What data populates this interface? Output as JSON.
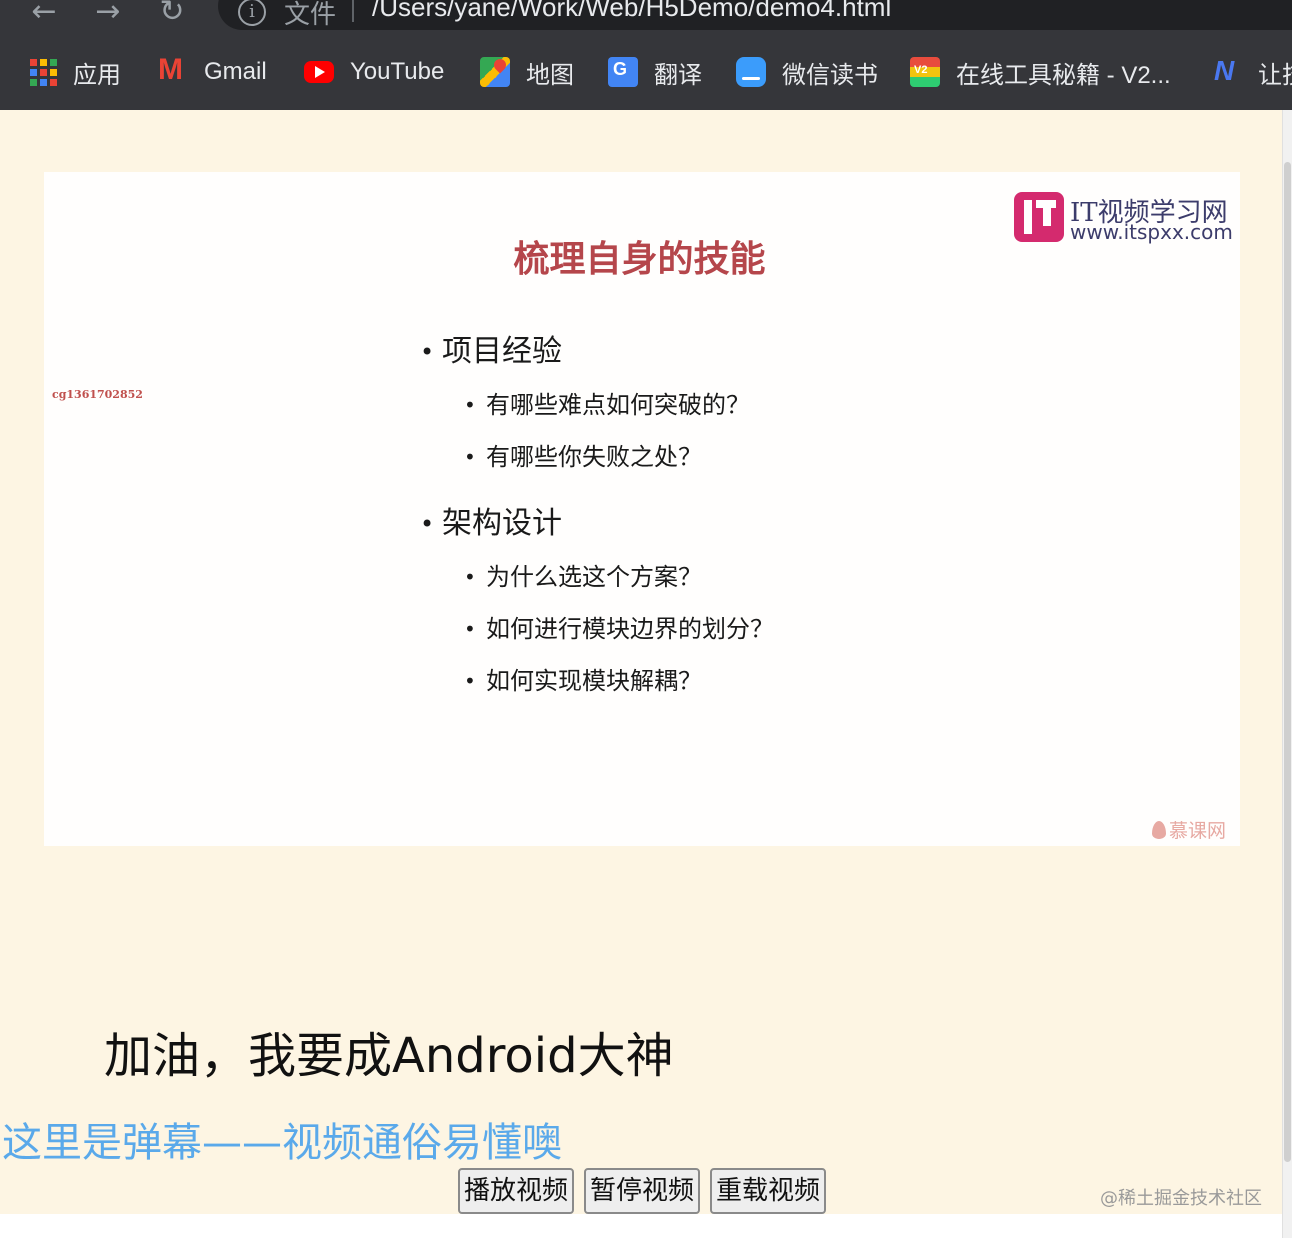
{
  "browser": {
    "address_label": "文件",
    "url": "/Users/yane/Work/Web/H5Demo/demo4.html",
    "info_icon": "i",
    "bookmarks": [
      {
        "label": "应用",
        "icon": "apps-grid-icon"
      },
      {
        "label": "Gmail",
        "icon": "gmail-icon"
      },
      {
        "label": "YouTube",
        "icon": "youtube-icon"
      },
      {
        "label": "地图",
        "icon": "maps-icon"
      },
      {
        "label": "翻译",
        "icon": "translate-icon"
      },
      {
        "label": "微信读书",
        "icon": "weread-icon"
      },
      {
        "label": "在线工具秘籍 - V2...",
        "icon": "v2-icon"
      },
      {
        "label": "让技",
        "icon": "n-icon"
      }
    ]
  },
  "video": {
    "slide_title": "梳理自身的技能",
    "watermark_id": "cg1361702852",
    "logo_name": "IT视频学习网",
    "logo_site": "www.itspxx.com",
    "mooc_watermark": "慕课网",
    "sections": [
      {
        "heading": "项目经验",
        "items": [
          "有哪些难点如何突破的？",
          "有哪些你失败之处？"
        ]
      },
      {
        "heading": "架构设计",
        "items": [
          "为什么选这个方案？",
          "如何进行模块边界的划分？",
          "如何实现模块解耦？"
        ]
      }
    ]
  },
  "page": {
    "headline": "加油，我要成Android大神",
    "danmaku": "这里是弹幕——视频通俗易懂噢",
    "buttons": {
      "play": "播放视频",
      "pause": "暂停视频",
      "reload": "重载视频"
    },
    "footer_watermark": "@稀土掘金技术社区"
  },
  "colors": {
    "page_background": "#fdf5e3",
    "slide_title": "#b5464b",
    "danmaku": "#5aa9ea",
    "browser_chrome": "#35363a"
  }
}
